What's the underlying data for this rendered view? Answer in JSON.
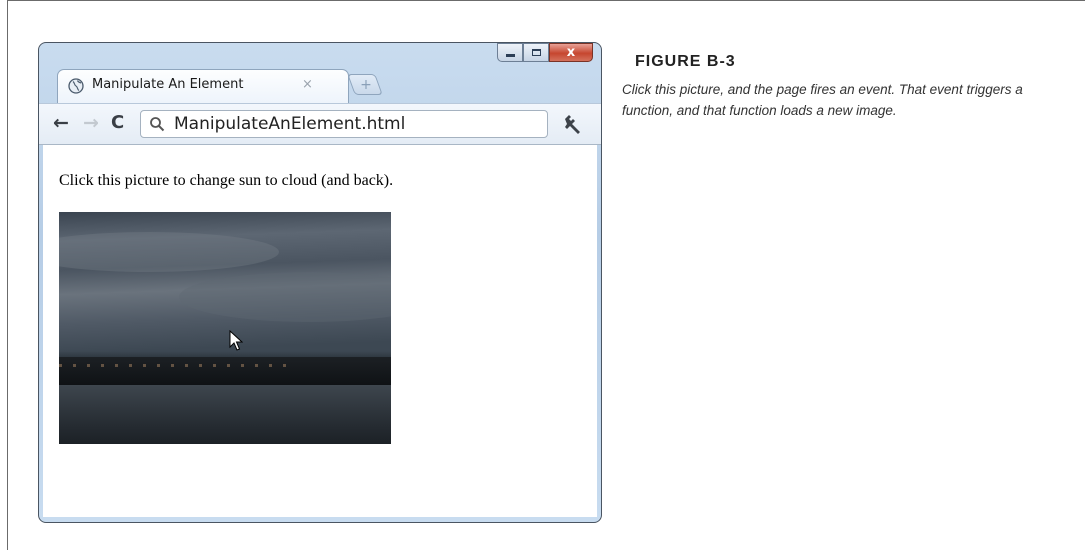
{
  "browser": {
    "tab_title": "Manipulate An Element",
    "tab_close_glyph": "×",
    "new_tab_glyph": "+",
    "window_close_glyph": "x",
    "back_glyph": "←",
    "forward_glyph": "→",
    "reload_glyph": "C",
    "address": "ManipulateAnElement.html",
    "icons": {
      "tab": "globe-icon",
      "back": "back-arrow-icon",
      "forward": "forward-arrow-icon",
      "reload": "reload-icon",
      "search": "search-icon",
      "menu": "wrench-icon",
      "minimize": "minimize-icon",
      "maximize": "maximize-icon",
      "close": "close-icon"
    }
  },
  "page": {
    "instruction": "Click this picture to change sun to cloud (and back).",
    "image_subject": "cloud"
  },
  "figure": {
    "label": "FIGURE B-3",
    "caption": "Click this picture, and the page fires an event. That event triggers a function, and that function loads a new image."
  },
  "colors": {
    "window_frame": "#b6cde6",
    "close_button": "#c6462f",
    "caption_text": "#333333"
  }
}
